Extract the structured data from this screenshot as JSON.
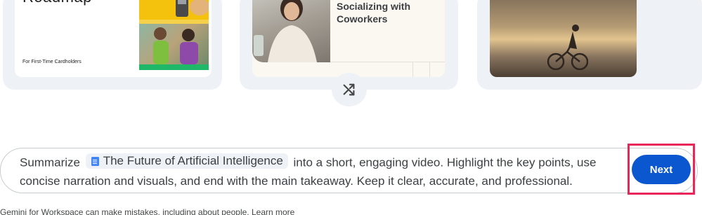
{
  "cards": [
    {
      "title": "Roadmap",
      "subtitle": "For First-Time Cardholders"
    },
    {
      "title_line1": "Socializing with",
      "title_line2": "Coworkers"
    },
    {}
  ],
  "prompt": {
    "before": "Summarize",
    "chip": "The Future of Artificial Intelligence",
    "after": "into a short, engaging video. Highlight the key points, use concise narration and visuals, and end with the main takeaway. Keep it clear, accurate, and professional."
  },
  "next_label": "Next",
  "disclaimer": {
    "text": "Gemini for Workspace can make mistakes, including about people.",
    "link": "Learn more"
  },
  "colors": {
    "primary": "#0b57d0",
    "highlight": "#e8265a",
    "accent_green": "#1fb868",
    "accent_yellow": "#f4c20d"
  }
}
